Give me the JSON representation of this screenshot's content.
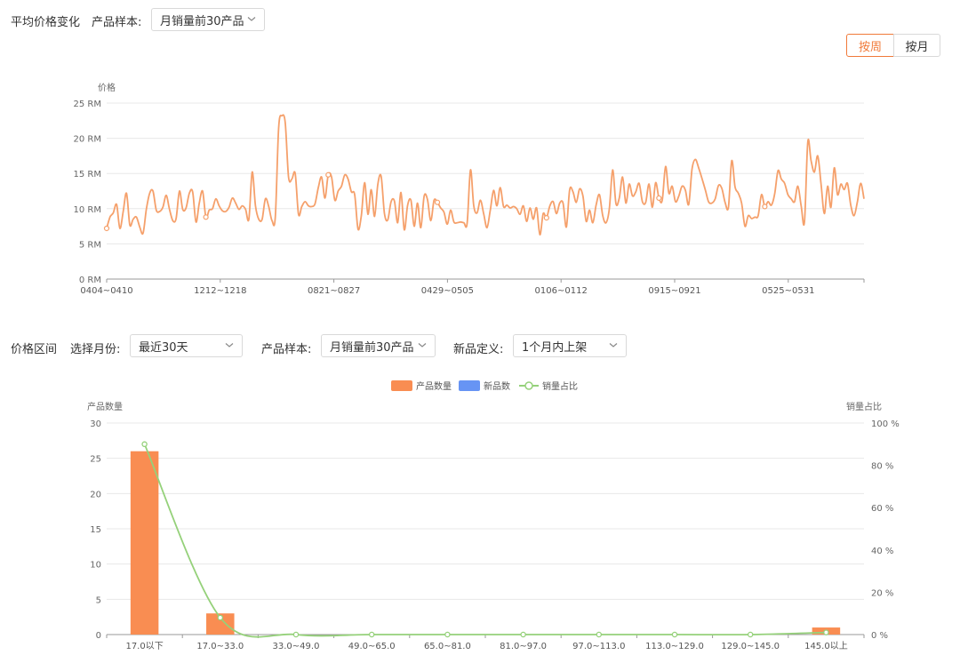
{
  "top": {
    "title": "平均价格变化",
    "sample_label": "产品样本:",
    "sample_value": "月销量前30产品",
    "toggle_week": "按周",
    "toggle_month": "按月",
    "accent": "#f07a3a"
  },
  "bottom": {
    "title": "价格区间",
    "month_label": "选择月份:",
    "month_value": "最近30天",
    "sample_label": "产品样本:",
    "sample_value": "月销量前30产品",
    "newdef_label": "新品定义:",
    "newdef_value": "1个月内上架"
  },
  "chart_data": [
    {
      "type": "line",
      "ylabel": "价格",
      "ylim": [
        0,
        25
      ],
      "y_ticks": [
        "0 RM",
        "5 RM",
        "10 RM",
        "15 RM",
        "20 RM",
        "25 RM"
      ],
      "x_tick_labels": [
        "0404~0410",
        "1212~1218",
        "0821~0827",
        "0429~0505",
        "0106~0112",
        "0915~0921",
        "0525~0531"
      ],
      "grid": true,
      "series": [
        {
          "color": "#f5a06b",
          "values": [
            7.2,
            8.8,
            9.4,
            10.6,
            7.2,
            9.6,
            12.2,
            7.7,
            8.5,
            8.8,
            7.4,
            6.5,
            9.9,
            12.2,
            12.5,
            9.8,
            9.6,
            10.2,
            11.9,
            9.9,
            8.3,
            8.6,
            12.5,
            9.9,
            10.1,
            12.2,
            12.4,
            8.1,
            10.8,
            12.5,
            8.8,
            9.8,
            10.0,
            11.4,
            10.4,
            9.7,
            9.6,
            10.2,
            11.5,
            10.8,
            9.9,
            10.4,
            9.9,
            8.5,
            15.2,
            10.4,
            8.5,
            8.5,
            11.4,
            10.3,
            8.3,
            8.8,
            21.5,
            23.2,
            22.2,
            14.5,
            14.2,
            15.0,
            9.2,
            10.3,
            11.0,
            10.4,
            10.3,
            10.7,
            13.0,
            14.5,
            11.5,
            14.8,
            14.5,
            11.2,
            12.5,
            13.2,
            14.8,
            14.2,
            12.4,
            12.0,
            7.1,
            9.0,
            13.7,
            9.2,
            12.7,
            8.9,
            13.5,
            14.6,
            9.3,
            8.4,
            11.0,
            11.1,
            8.0,
            12.3,
            7.0,
            10.5,
            11.2,
            7.5,
            10.8,
            7.3,
            11.8,
            11.3,
            8.3,
            11.2,
            10.9,
            10.1,
            9.5,
            7.8,
            9.8,
            8.1,
            8.0,
            8.1,
            8.0,
            7.9,
            15.5,
            10.4,
            9.4,
            11.2,
            9.3,
            7.3,
            9.8,
            12.6,
            10.4,
            13.0,
            10.3,
            10.5,
            10.1,
            10.3,
            10.0,
            9.2,
            10.4,
            8.2,
            10.1,
            8.5,
            10.1,
            6.3,
            9.3,
            8.7,
            10.4,
            11.0,
            9.3,
            10.8,
            10.8,
            7.4,
            12.7,
            12.4,
            10.9,
            12.8,
            11.8,
            8.2,
            9.8,
            8.0,
            10.5,
            12.0,
            9.0,
            8.0,
            10.0,
            15.5,
            10.7,
            11.5,
            14.5,
            10.8,
            13.5,
            11.8,
            12.4,
            13.6,
            11.0,
            10.9,
            13.5,
            10.2,
            13.7,
            11.5,
            11.2,
            16.0,
            12.2,
            13.2,
            11.0,
            11.8,
            13.2,
            12.6,
            10.6,
            15.6,
            17.0,
            15.8,
            14.3,
            12.7,
            11.0,
            10.8,
            11.4,
            13.3,
            12.9,
            10.9,
            10.2,
            16.8,
            13.1,
            12.2,
            10.8,
            7.5,
            9.0,
            8.6,
            8.8,
            9.0,
            12.0,
            10.3,
            11.0,
            10.5,
            12.1,
            15.4,
            14.2,
            13.6,
            12.0,
            11.4,
            11.0,
            13.2,
            10.4,
            8.1,
            19.5,
            16.8,
            15.2,
            17.5,
            13.6,
            9.3,
            13.2,
            10.2,
            15.8,
            12.0,
            13.5,
            12.7,
            13.6,
            10.5,
            9.0,
            11.0,
            13.6,
            11.4
          ],
          "markers": [
            0,
            30,
            67,
            100,
            133,
            167,
            199
          ]
        }
      ]
    },
    {
      "type": "bar",
      "categories": [
        "17.0以下",
        "17.0~33.0",
        "33.0~49.0",
        "49.0~65.0",
        "65.0~81.0",
        "81.0~97.0",
        "97.0~113.0",
        "113.0~129.0",
        "129.0~145.0",
        "145.0以上"
      ],
      "ylabel": "产品数量",
      "y2label": "销量占比",
      "ylim": [
        0,
        30
      ],
      "y_ticks": [
        "0",
        "5",
        "10",
        "15",
        "20",
        "25",
        "30"
      ],
      "y2lim": [
        0,
        100
      ],
      "y2_ticks": [
        "0 %",
        "20 %",
        "40 %",
        "60 %",
        "80 %",
        "100 %"
      ],
      "legend_position": "top-center",
      "series": [
        {
          "name": "产品数量",
          "kind": "bar",
          "color": "#f98d52",
          "values": [
            26,
            3,
            0,
            0,
            0,
            0,
            0,
            0,
            0,
            1
          ]
        },
        {
          "name": "新品数",
          "kind": "bar",
          "color": "#6794f4",
          "values": [
            0,
            0,
            0,
            0,
            0,
            0,
            0,
            0,
            0,
            0
          ]
        },
        {
          "name": "销量占比",
          "kind": "line",
          "color": "#95d17a",
          "values": [
            90,
            8,
            0,
            0,
            0,
            0,
            0,
            0,
            0,
            1
          ]
        }
      ]
    }
  ]
}
